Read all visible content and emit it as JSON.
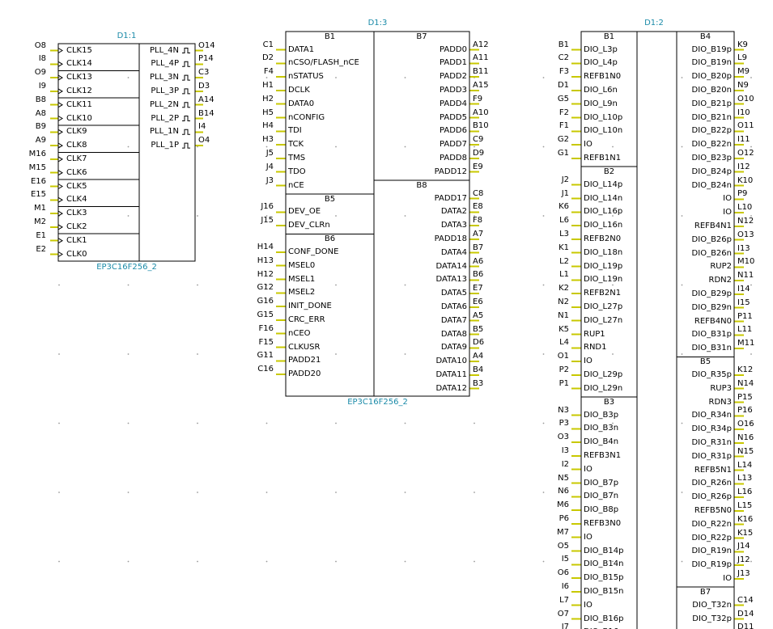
{
  "colors": {
    "line": "#000000",
    "pin_stub": "#c8c800",
    "ref_text": "#1a8aa8",
    "grid_dot": "#9a9a9a",
    "background": "#ffffff"
  },
  "parts": [
    {
      "ref": "D1:1",
      "part_number": "EP3C16F256_2",
      "columns": [
        {
          "banks": [
            {
              "name": "",
              "pins": [
                {
                  "num": "O8",
                  "name": "CLK15",
                  "sym": "clk"
                },
                {
                  "num": "I8",
                  "name": "CLK14",
                  "sym": "clk"
                },
                {
                  "num": "O9",
                  "name": "CLK13",
                  "sym": "clk"
                },
                {
                  "num": "I9",
                  "name": "CLK12",
                  "sym": "clk"
                },
                {
                  "num": "B8",
                  "name": "CLK11",
                  "sym": "clk"
                },
                {
                  "num": "A8",
                  "name": "CLK10",
                  "sym": "clk"
                },
                {
                  "num": "B9",
                  "name": "CLK9",
                  "sym": "clk"
                },
                {
                  "num": "A9",
                  "name": "CLK8",
                  "sym": "clk"
                },
                {
                  "num": "M16",
                  "name": "CLK7",
                  "sym": "clk"
                },
                {
                  "num": "M15",
                  "name": "CLK6",
                  "sym": "clk"
                },
                {
                  "num": "E16",
                  "name": "CLK5",
                  "sym": "clk"
                },
                {
                  "num": "E15",
                  "name": "CLK4",
                  "sym": "clk"
                },
                {
                  "num": "M1",
                  "name": "CLK3",
                  "sym": "clk"
                },
                {
                  "num": "M2",
                  "name": "CLK2",
                  "sym": "clk"
                },
                {
                  "num": "E1",
                  "name": "CLK1",
                  "sym": "clk"
                },
                {
                  "num": "E2",
                  "name": "CLK0",
                  "sym": "clk"
                }
              ]
            }
          ]
        },
        {
          "banks": [
            {
              "name": "",
              "pins": [
                {
                  "num": "O14",
                  "name": "PLL_4N",
                  "sym": "pulse"
                },
                {
                  "num": "P14",
                  "name": "PLL_4P",
                  "sym": "pulse"
                },
                {
                  "num": "C3",
                  "name": "PLL_3N",
                  "sym": "pulse"
                },
                {
                  "num": "D3",
                  "name": "PLL_3P",
                  "sym": "pulse"
                },
                {
                  "num": "A14",
                  "name": "PLL_2N",
                  "sym": "pulse"
                },
                {
                  "num": "B14",
                  "name": "PLL_2P",
                  "sym": "pulse"
                },
                {
                  "num": "I4",
                  "name": "PLL_1N",
                  "sym": "pulse"
                },
                {
                  "num": "O4",
                  "name": "PLL_1P",
                  "sym": "pulse"
                }
              ]
            }
          ]
        }
      ]
    },
    {
      "ref": "D1:3",
      "part_number": "EP3C16F256_2",
      "columns": [
        {
          "banks": [
            {
              "name": "B1",
              "pins": [
                {
                  "num": "C1",
                  "name": "DATA1"
                },
                {
                  "num": "D2",
                  "name": "nCSO/FLASH_nCE"
                },
                {
                  "num": "F4",
                  "name": "nSTATUS"
                },
                {
                  "num": "H1",
                  "name": "DCLK"
                },
                {
                  "num": "H2",
                  "name": "DATA0"
                },
                {
                  "num": "H5",
                  "name": "nCONFIG"
                },
                {
                  "num": "H4",
                  "name": "TDI"
                },
                {
                  "num": "H3",
                  "name": "TCK"
                },
                {
                  "num": "J5",
                  "name": "TMS"
                },
                {
                  "num": "J4",
                  "name": "TDO"
                },
                {
                  "num": "J3",
                  "name": "nCE"
                }
              ]
            },
            {
              "name": "B5",
              "pins": [
                {
                  "num": "J16",
                  "name": "DEV_OE"
                },
                {
                  "num": "J15",
                  "name": "DEV_CLRn"
                }
              ]
            },
            {
              "name": "B6",
              "pins": [
                {
                  "num": "H14",
                  "name": "CONF_DONE"
                },
                {
                  "num": "H13",
                  "name": "MSEL0"
                },
                {
                  "num": "H12",
                  "name": "MSEL1"
                },
                {
                  "num": "G12",
                  "name": "MSEL2"
                },
                {
                  "num": "G16",
                  "name": "INIT_DONE"
                },
                {
                  "num": "G15",
                  "name": "CRC_ERR"
                },
                {
                  "num": "F16",
                  "name": "nCEO"
                },
                {
                  "num": "F15",
                  "name": "CLKUSR"
                },
                {
                  "num": "G11",
                  "name": "PADD21"
                },
                {
                  "num": "C16",
                  "name": "PADD20"
                }
              ]
            }
          ]
        },
        {
          "banks": [
            {
              "name": "B7",
              "pins": [
                {
                  "num": "A12",
                  "name": "PADD0"
                },
                {
                  "num": "A11",
                  "name": "PADD1"
                },
                {
                  "num": "B11",
                  "name": "PADD2"
                },
                {
                  "num": "A15",
                  "name": "PADD3"
                },
                {
                  "num": "F9",
                  "name": "PADD4"
                },
                {
                  "num": "A10",
                  "name": "PADD5"
                },
                {
                  "num": "B10",
                  "name": "PADD6"
                },
                {
                  "num": "C9",
                  "name": "PADD7"
                },
                {
                  "num": "D9",
                  "name": "PADD8"
                },
                {
                  "num": "E9",
                  "name": "PADD12"
                }
              ]
            },
            {
              "name": "B8",
              "pins": [
                {
                  "num": "C8",
                  "name": "PADD17"
                },
                {
                  "num": "E8",
                  "name": "DATA2"
                },
                {
                  "num": "F8",
                  "name": "DATA3"
                },
                {
                  "num": "A7",
                  "name": "PADD18"
                },
                {
                  "num": "B7",
                  "name": "DATA4"
                },
                {
                  "num": "A6",
                  "name": "DATA14"
                },
                {
                  "num": "B6",
                  "name": "DATA13"
                },
                {
                  "num": "E7",
                  "name": "DATA5"
                },
                {
                  "num": "E6",
                  "name": "DATA6"
                },
                {
                  "num": "A5",
                  "name": "DATA7"
                },
                {
                  "num": "B5",
                  "name": "DATA8"
                },
                {
                  "num": "D6",
                  "name": "DATA9"
                },
                {
                  "num": "A4",
                  "name": "DATA10"
                },
                {
                  "num": "B4",
                  "name": "DATA11"
                },
                {
                  "num": "B3",
                  "name": "DATA12"
                }
              ]
            }
          ]
        }
      ]
    },
    {
      "ref": "D1:2",
      "part_number": "",
      "columns": [
        {
          "banks": [
            {
              "name": "B1",
              "pins": [
                {
                  "num": "B1",
                  "name": "DIO_L3p"
                },
                {
                  "num": "C2",
                  "name": "DIO_L4p"
                },
                {
                  "num": "F3",
                  "name": "REFB1N0"
                },
                {
                  "num": "D1",
                  "name": "DIO_L6n"
                },
                {
                  "num": "G5",
                  "name": "DIO_L9n"
                },
                {
                  "num": "F2",
                  "name": "DIO_L10p"
                },
                {
                  "num": "F1",
                  "name": "DIO_L10n"
                },
                {
                  "num": "G2",
                  "name": "IO"
                },
                {
                  "num": "G1",
                  "name": "REFB1N1"
                }
              ]
            },
            {
              "name": "B2",
              "pins": [
                {
                  "num": "J2",
                  "name": "DIO_L14p"
                },
                {
                  "num": "J1",
                  "name": "DIO_L14n"
                },
                {
                  "num": "K6",
                  "name": "DIO_L16p"
                },
                {
                  "num": "L6",
                  "name": "DIO_L16n"
                },
                {
                  "num": "L3",
                  "name": "REFB2N0"
                },
                {
                  "num": "K1",
                  "name": "DIO_L18n"
                },
                {
                  "num": "L2",
                  "name": "DIO_L19p"
                },
                {
                  "num": "L1",
                  "name": "DIO_L19n"
                },
                {
                  "num": "K2",
                  "name": "REFB2N1"
                },
                {
                  "num": "N2",
                  "name": "DIO_L27p"
                },
                {
                  "num": "N1",
                  "name": "DIO_L27n"
                },
                {
                  "num": "K5",
                  "name": "RUP1"
                },
                {
                  "num": "L4",
                  "name": "RND1"
                },
                {
                  "num": "O1",
                  "name": "IO"
                },
                {
                  "num": "P2",
                  "name": "DIO_L29p"
                },
                {
                  "num": "P1",
                  "name": "DIO_L29n"
                }
              ]
            },
            {
              "name": "B3",
              "pins": [
                {
                  "num": "N3",
                  "name": "DIO_B3p"
                },
                {
                  "num": "P3",
                  "name": "DIO_B3n"
                },
                {
                  "num": "O3",
                  "name": "DIO_B4n"
                },
                {
                  "num": "I3",
                  "name": "REFB3N1"
                },
                {
                  "num": "I2",
                  "name": "IO"
                },
                {
                  "num": "N5",
                  "name": "DIO_B7p"
                },
                {
                  "num": "N6",
                  "name": "DIO_B7n"
                },
                {
                  "num": "M6",
                  "name": "DIO_B8p"
                },
                {
                  "num": "P6",
                  "name": "REFB3N0"
                },
                {
                  "num": "M7",
                  "name": "IO"
                },
                {
                  "num": "O5",
                  "name": "DIO_B14p"
                },
                {
                  "num": "I5",
                  "name": "DIO_B14n"
                },
                {
                  "num": "O6",
                  "name": "DIO_B15p"
                },
                {
                  "num": "I6",
                  "name": "DIO_B15n"
                },
                {
                  "num": "L7",
                  "name": "IO"
                },
                {
                  "num": "O7",
                  "name": "DIO_B16p"
                },
                {
                  "num": "I7",
                  "name": "DIO_B16n"
                }
              ]
            }
          ]
        },
        {
          "banks": [
            {
              "name": "B4",
              "pins": [
                {
                  "num": "K9",
                  "name": "DIO_B19p"
                },
                {
                  "num": "L9",
                  "name": "DIO_B19n"
                },
                {
                  "num": "M9",
                  "name": "DIO_B20p"
                },
                {
                  "num": "N9",
                  "name": "DIO_B20n"
                },
                {
                  "num": "O10",
                  "name": "DIO_B21p"
                },
                {
                  "num": "I10",
                  "name": "DIO_B21n"
                },
                {
                  "num": "O11",
                  "name": "DIO_B22p"
                },
                {
                  "num": "I11",
                  "name": "DIO_B22n"
                },
                {
                  "num": "O12",
                  "name": "DIO_B23p"
                },
                {
                  "num": "I12",
                  "name": "DIO_B24p"
                },
                {
                  "num": "K10",
                  "name": "DIO_B24n"
                },
                {
                  "num": "P9",
                  "name": "IO"
                },
                {
                  "num": "L10",
                  "name": "IO"
                },
                {
                  "num": "N12",
                  "name": "REFB4N1"
                },
                {
                  "num": "O13",
                  "name": "DIO_B26p"
                },
                {
                  "num": "I13",
                  "name": "DIO_B26n"
                },
                {
                  "num": "M10",
                  "name": "RUP2"
                },
                {
                  "num": "N11",
                  "name": "RDN2"
                },
                {
                  "num": "I14",
                  "name": "DIO_B29p"
                },
                {
                  "num": "I15",
                  "name": "DIO_B29n"
                },
                {
                  "num": "P11",
                  "name": "REFB4N0"
                },
                {
                  "num": "L11",
                  "name": "DIO_B31p"
                },
                {
                  "num": "M11",
                  "name": "DIO_B31n"
                }
              ]
            },
            {
              "name": "B5",
              "pins": [
                {
                  "num": "K12",
                  "name": "DIO_R35p"
                },
                {
                  "num": "N14",
                  "name": "RUP3"
                },
                {
                  "num": "P15",
                  "name": "RDN3"
                },
                {
                  "num": "P16",
                  "name": "DIO_R34n"
                },
                {
                  "num": "O16",
                  "name": "DIO_R34p"
                },
                {
                  "num": "N16",
                  "name": "DIO_R31n"
                },
                {
                  "num": "N15",
                  "name": "DIO_R31p"
                },
                {
                  "num": "L14",
                  "name": "REFB5N1"
                },
                {
                  "num": "L13",
                  "name": "DIO_R26n"
                },
                {
                  "num": "L16",
                  "name": "DIO_R26p"
                },
                {
                  "num": "L15",
                  "name": "REFB5N0"
                },
                {
                  "num": "K16",
                  "name": "DIO_R22n"
                },
                {
                  "num": "K15",
                  "name": "DIO_R22p"
                },
                {
                  "num": "J14",
                  "name": "DIO_R19n"
                },
                {
                  "num": "J12",
                  "name": "DIO_R19p"
                },
                {
                  "num": "J13",
                  "name": "IO"
                }
              ]
            },
            {
              "name": "B7",
              "pins": [
                {
                  "num": "C14",
                  "name": "DIO_T32n"
                },
                {
                  "num": "D14",
                  "name": "DIO_T32p"
                },
                {
                  "num": "D11",
                  "name": ""
                }
              ]
            }
          ]
        }
      ]
    }
  ]
}
